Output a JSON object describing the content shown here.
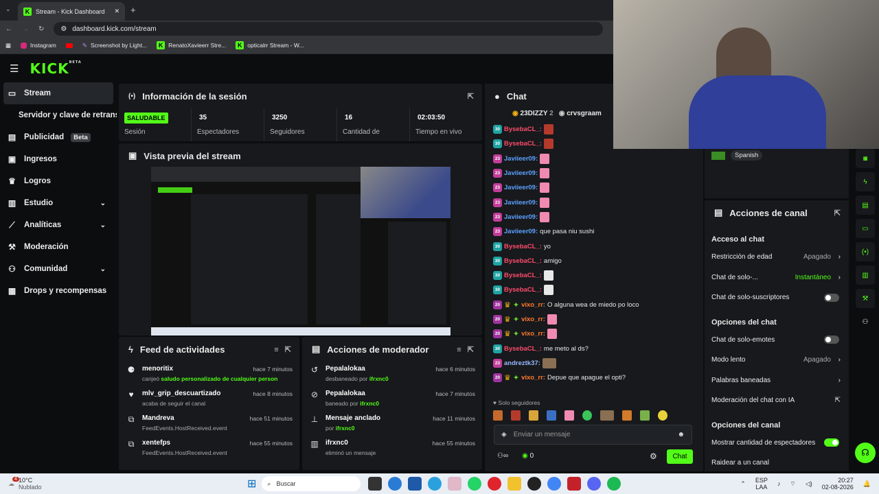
{
  "browser": {
    "tab_title": "Stream - Kick Dashboard",
    "url": "dashboard.kick.com/stream",
    "bookmarks": [
      "Instagram",
      "Screenshot by Light...",
      "RenatoXavieerr Stre...",
      "opticalrr Stream - W..."
    ]
  },
  "kick": {
    "logo": "KICK",
    "logo_badge": "BETA"
  },
  "sidebar": [
    {
      "label": "Stream",
      "icon": "stream-icon"
    },
    {
      "label": "Servidor y clave de retransm",
      "icon": ""
    },
    {
      "label": "Publicidad",
      "badge": "Beta",
      "icon": "megaphone-icon"
    },
    {
      "label": "Ingresos",
      "icon": "money-icon"
    },
    {
      "label": "Logros",
      "icon": "trophy-icon"
    },
    {
      "label": "Estudio",
      "icon": "studio-icon"
    },
    {
      "label": "Analíticas",
      "icon": "analytics-icon"
    },
    {
      "label": "Moderación",
      "icon": "hammer-icon"
    },
    {
      "label": "Comunidad",
      "icon": "community-icon"
    },
    {
      "label": "Drops y recompensas",
      "icon": "gift-icon"
    }
  ],
  "session": {
    "title": "Información de la sesión",
    "status": "SALUDABLE",
    "status_label": "Sesión",
    "stats": [
      {
        "value": "35",
        "label": "Espectadores"
      },
      {
        "value": "3250",
        "label": "Seguidores"
      },
      {
        "value": "16",
        "label": "Cantidad de"
      },
      {
        "value": "02:03:50",
        "label": "Tiempo en vivo"
      }
    ]
  },
  "preview": {
    "title": "Vista previa del stream"
  },
  "feed": {
    "title": "Feed de actividades",
    "items": [
      {
        "name": "menoritix",
        "desc_pre": "canjeó ",
        "desc_hl": "saludo personalizado de cualquier person",
        "time": "hace 7 minutos"
      },
      {
        "name": "mlv_grip_descuartizado",
        "desc_pre": "acaba de seguir el canal",
        "desc_hl": "",
        "time": "hace 8 minutos"
      },
      {
        "name": "Mandreva",
        "desc_pre": "FeedEvents.HostReceived.event",
        "desc_hl": "",
        "time": "hace 51 minutos"
      },
      {
        "name": "xentefps",
        "desc_pre": "FeedEvents.HostReceived.event",
        "desc_hl": "",
        "time": "hace 55 minutos"
      }
    ]
  },
  "mod": {
    "title": "Acciones de moderador",
    "items": [
      {
        "name": "Pepalalokaa",
        "desc_pre": "desbaneado por ",
        "desc_hl": "ifrxnc0",
        "time": "hace 6 minutos"
      },
      {
        "name": "Pepalalokaa",
        "desc_pre": "baneado por ",
        "desc_hl": "ifrxnc0",
        "time": "hace 7 minutos"
      },
      {
        "name": "Mensaje anclado",
        "desc_pre": "por ",
        "desc_hl": "ifrxnc0",
        "time": "hace 11 minutos"
      },
      {
        "name": "ifrxnc0",
        "desc_pre": "eliminó un mensaje",
        "desc_hl": "",
        "time": "hace 55 minutos"
      }
    ]
  },
  "chat": {
    "title": "Chat",
    "top1_name": "23DIZZY",
    "top1_count": "2",
    "top2_name": "crvsgraam",
    "followers_only": "Solo seguidores",
    "placeholder": "Enviar un mensaje",
    "count": "0",
    "send": "Chat",
    "messages": [
      {
        "badge": "30",
        "user": "BysebaCL_:",
        "cls": "u-red",
        "emote": "e-red",
        "text": ""
      },
      {
        "badge": "30",
        "user": "BysebaCL_:",
        "cls": "u-red",
        "emote": "e-red",
        "text": ""
      },
      {
        "badge": "23",
        "user": "Javiieer09:",
        "cls": "u-blue",
        "emote": "e-pink",
        "text": ""
      },
      {
        "badge": "23",
        "user": "Javiieer09:",
        "cls": "u-blue",
        "emote": "e-pink",
        "text": ""
      },
      {
        "badge": "23",
        "user": "Javiieer09:",
        "cls": "u-blue",
        "emote": "e-pink",
        "text": ""
      },
      {
        "badge": "23",
        "user": "Javiieer09:",
        "cls": "u-blue",
        "emote": "e-pink",
        "text": ""
      },
      {
        "badge": "23",
        "user": "Javiieer09:",
        "cls": "u-blue",
        "emote": "e-pink",
        "text": ""
      },
      {
        "badge": "23",
        "user": "Javiieer09:",
        "cls": "u-blue",
        "emote": "",
        "text": "que pasa niu sushi"
      },
      {
        "badge": "30",
        "user": "BysebaCL_:",
        "cls": "u-red",
        "emote": "",
        "text": "yo"
      },
      {
        "badge": "30",
        "user": "BysebaCL_:",
        "cls": "u-red",
        "emote": "",
        "text": "amigo"
      },
      {
        "badge": "30",
        "user": "BysebaCL_:",
        "cls": "u-red",
        "emote": "e-skull",
        "text": ""
      },
      {
        "badge": "30",
        "user": "BysebaCL_:",
        "cls": "u-red",
        "emote": "e-skull",
        "text": ""
      },
      {
        "badge": "20",
        "user": "vixo_rr:",
        "cls": "u-orange",
        "emote": "",
        "text": "O alguna wea de miedo po loco",
        "extra": true
      },
      {
        "badge": "20",
        "user": "vixo_rr:",
        "cls": "u-orange",
        "emote": "e-pink",
        "text": "",
        "extra": true
      },
      {
        "badge": "20",
        "user": "vixo_rr:",
        "cls": "u-orange",
        "emote": "e-pink",
        "text": "",
        "extra": true
      },
      {
        "badge": "30",
        "user": "BysebaCL_:",
        "cls": "u-red",
        "emote": "",
        "text": "me meto al ds?"
      },
      {
        "badge": "23",
        "user": "andreztk37:",
        "cls": "u-light",
        "emote": "e-pic",
        "text": ""
      },
      {
        "badge": "20",
        "user": "vixo_rr:",
        "cls": "u-orange",
        "emote": "",
        "text": "Depue que apague el opti?",
        "extra": true
      }
    ]
  },
  "language": "Spanish",
  "actions": {
    "title": "Acciones de canal",
    "sec1": "Acceso al chat",
    "age": "Restricción de edad",
    "age_val": "Apagado",
    "solo": "Chat de solo-...",
    "solo_val": "Instantáneo",
    "subs": "Chat de solo-suscriptores",
    "sec2": "Opciones del chat",
    "emotes": "Chat de solo-emotes",
    "slow": "Modo lento",
    "slow_val": "Apagado",
    "banned": "Palabras baneadas",
    "ai": "Moderación del chat con IA",
    "sec3": "Opciones del canal",
    "viewers": "Mostrar cantidad de espectadores",
    "raid": "Raidear a un canal"
  },
  "taskbar": {
    "temp": "10°C",
    "weather": "Nublado",
    "badge": "4",
    "search": "Buscar",
    "lang1": "ESP",
    "lang2": "LAA",
    "time": "20:27",
    "date": "02-08-2026"
  },
  "colors": {
    "accent": "#53fc18",
    "panel": "#17191c",
    "bg": "#0b0d0f"
  }
}
